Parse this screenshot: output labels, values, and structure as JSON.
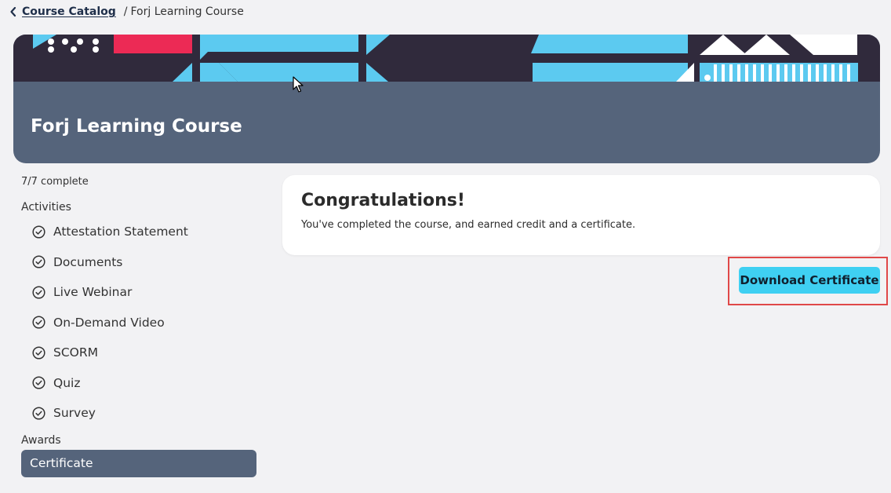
{
  "breadcrumb": {
    "back_label": "Course Catalog",
    "separator": "/",
    "current": "Forj Learning Course"
  },
  "hero": {
    "title": "Forj Learning Course"
  },
  "sidebar": {
    "progress": "7/7 complete",
    "activities_label": "Activities",
    "activities": [
      {
        "label": "Attestation Statement",
        "icon": "check-circle-icon",
        "completed": true
      },
      {
        "label": "Documents",
        "icon": "check-circle-icon",
        "completed": true
      },
      {
        "label": "Live Webinar",
        "icon": "check-circle-icon",
        "completed": true
      },
      {
        "label": "On-Demand Video",
        "icon": "check-circle-icon",
        "completed": true
      },
      {
        "label": "SCORM",
        "icon": "check-circle-icon",
        "completed": true
      },
      {
        "label": "Quiz",
        "icon": "check-circle-icon",
        "completed": true
      },
      {
        "label": "Survey",
        "icon": "check-circle-icon",
        "completed": true
      }
    ],
    "awards_label": "Awards",
    "awards": [
      {
        "label": "Certificate",
        "selected": true
      }
    ]
  },
  "main": {
    "card_title": "Congratulations!",
    "card_text": "You've completed the course, and earned credit and a certificate.",
    "download_label": "Download Certificate"
  },
  "colors": {
    "accent_button": "#3fd0f2",
    "hero_background": "#55647b",
    "highlight": "#e04848"
  }
}
